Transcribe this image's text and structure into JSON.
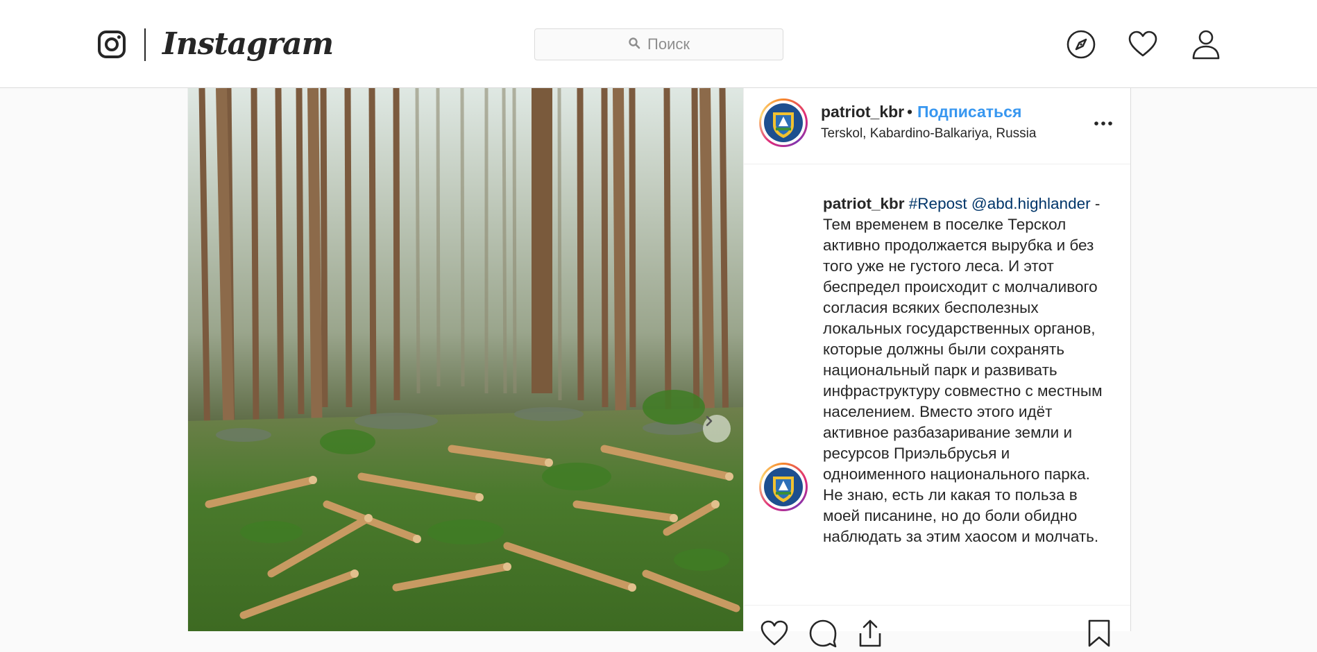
{
  "header": {
    "brand": "Instagram",
    "search": {
      "placeholder": "Поиск",
      "value": ""
    },
    "nav_icons": [
      "explore-compass-icon",
      "activity-heart-icon",
      "profile-person-icon"
    ]
  },
  "post": {
    "author": {
      "username": "patriot_kbr",
      "separator": "•",
      "follow_label": "Подписаться",
      "location": "Terskol, Kabardino-Balkariya, Russia"
    },
    "caption": {
      "username": "patriot_kbr",
      "hashtag": "#Repost",
      "mention": "@abd.highlander",
      "text": "- Тем временем в поселке Терскол активно продолжается вырубка и без того уже не густого леса. И этот беспредел происходит с молчаливого согласия всяких бесполезных локальных государственных органов, которые должны были сохранять национальный парк и развивать инфраструктуру совместно с местным населением. Вместо этого идёт активное разбазаривание земли и ресурсов Приэльбрусья и одноименного национального парка. Не знаю, есть ли какая то польза в моей писанине, но до боли обидно наблюдать за этим хаосом и молчать."
    },
    "media_description_icon": "forest-photo",
    "actions": [
      "like-heart-icon",
      "comment-bubble-icon",
      "share-icon",
      "save-bookmark-icon"
    ]
  },
  "colors": {
    "link_blue": "#3897f0",
    "hashtag_blue": "#003569",
    "text": "#262626",
    "border": "#dbdbdb"
  }
}
